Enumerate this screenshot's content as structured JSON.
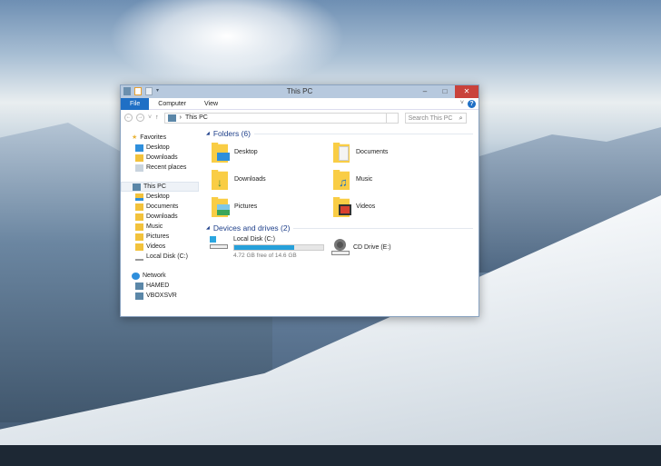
{
  "window": {
    "title": "This PC"
  },
  "ribbon": {
    "tabs": [
      "File",
      "Computer",
      "View"
    ],
    "help": "?"
  },
  "address": {
    "path": "This PC",
    "search_placeholder": "Search This PC"
  },
  "sidebar": {
    "favorites": {
      "label": "Favorites",
      "items": [
        "Desktop",
        "Downloads",
        "Recent places"
      ]
    },
    "this_pc": {
      "label": "This PC",
      "items": [
        "Desktop",
        "Documents",
        "Downloads",
        "Music",
        "Pictures",
        "Videos",
        "Local Disk (C:)"
      ]
    },
    "network": {
      "label": "Network",
      "items": [
        "HAMED",
        "VBOXSVR"
      ]
    }
  },
  "folders": {
    "header": "Folders (6)",
    "items": [
      "Desktop",
      "Documents",
      "Downloads",
      "Music",
      "Pictures",
      "Videos"
    ]
  },
  "drives": {
    "header": "Devices and drives (2)",
    "local": {
      "name": "Local Disk (C:)",
      "free": "4.72 GB free of 14.6 GB",
      "used_fraction": 0.677
    },
    "cd": {
      "name": "CD Drive (E:)"
    }
  },
  "colors": {
    "accent": "#1f6fc5",
    "close": "#c9423b",
    "bar": "#26a0da"
  }
}
